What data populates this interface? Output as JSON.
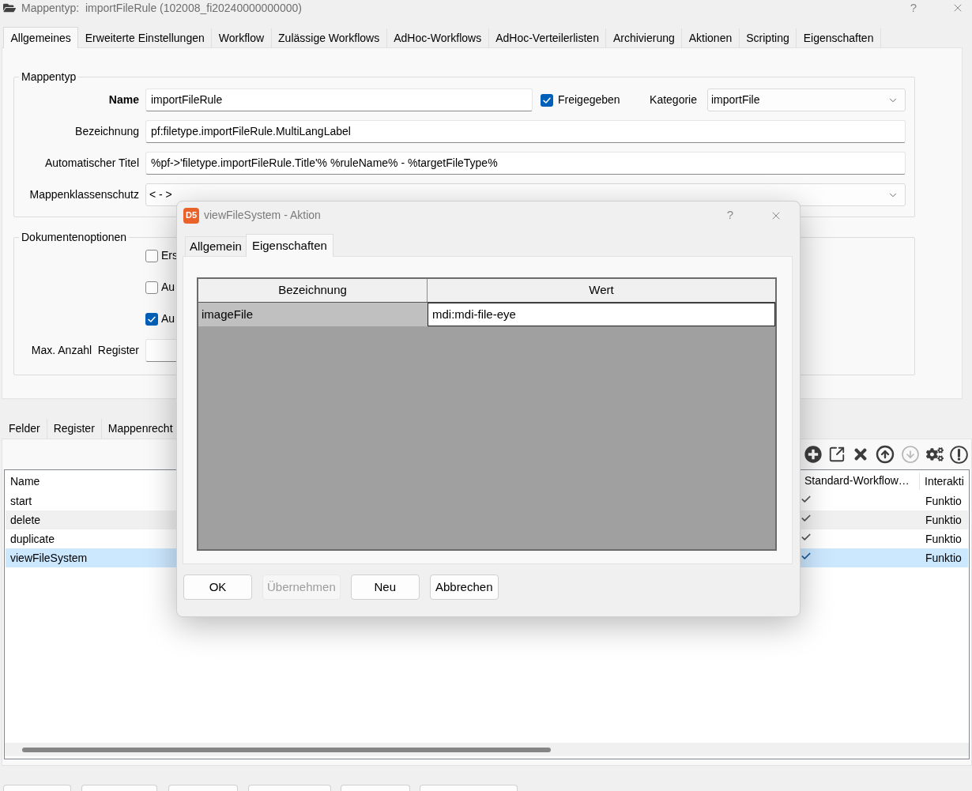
{
  "window": {
    "title": "Mappentyp:  importFileRule (102008_fi20240000000000)",
    "help": "?"
  },
  "tabs": [
    {
      "label": "Allgemeines",
      "selected": true
    },
    {
      "label": "Erweiterte Einstellungen",
      "selected": false
    },
    {
      "label": "Workflow",
      "selected": false
    },
    {
      "label": "Zulässige Workflows",
      "selected": false
    },
    {
      "label": "AdHoc-Workflows",
      "selected": false
    },
    {
      "label": "AdHoc-Verteilerlisten",
      "selected": false
    },
    {
      "label": "Archivierung",
      "selected": false
    },
    {
      "label": "Aktionen",
      "selected": false
    },
    {
      "label": "Scripting",
      "selected": false
    },
    {
      "label": "Eigenschaften",
      "selected": false
    }
  ],
  "mappentyp": {
    "legend": "Mappentyp",
    "name": {
      "label": "Name",
      "value": "importFileRule"
    },
    "released": {
      "label": "Freigegeben",
      "checked": true
    },
    "category": {
      "label": "Kategorie",
      "value": "importFile"
    },
    "designation": {
      "label": "Bezeichnung",
      "value": "pf:filetype.importFileRule.MultiLangLabel"
    },
    "auto_title": {
      "label": "Automatischer Titel",
      "value": "%pf->'filetype.importFileRule.Title'% %ruleName% - %targetFileType%"
    },
    "class_protection": {
      "label": "Mappenklassenschutz",
      "value": "< - >"
    }
  },
  "document_options": {
    "legend": "Dokumentenoptionen",
    "options": [
      {
        "label": "Ers",
        "checked": false
      },
      {
        "label": "Au",
        "checked": false
      },
      {
        "label": "Au",
        "checked": true
      }
    ],
    "max_register": {
      "label": "Max. Anzahl  Register"
    }
  },
  "lower_tabs": [
    {
      "label": "Felder",
      "selected": false
    },
    {
      "label": "Register",
      "selected": false
    },
    {
      "label": "Mappenrecht",
      "selected": false
    }
  ],
  "toolbar": [
    {
      "kind": "add",
      "disabled": false
    },
    {
      "kind": "open",
      "disabled": false
    },
    {
      "kind": "delete",
      "disabled": false
    },
    {
      "kind": "move_up",
      "disabled": false
    },
    {
      "kind": "move_down",
      "disabled": true
    },
    {
      "kind": "settings",
      "disabled": false
    },
    {
      "kind": "info",
      "disabled": false
    }
  ],
  "actions_table": {
    "columns": [
      "Name",
      "Standard-Workflow…",
      "Interakti"
    ],
    "rows": [
      {
        "name": "start",
        "standard_workflow": true,
        "interaction": "Funktio",
        "selected": false
      },
      {
        "name": "delete",
        "standard_workflow": true,
        "interaction": "Funktio",
        "selected": false
      },
      {
        "name": "duplicate",
        "standard_workflow": true,
        "interaction": "Funktio",
        "selected": false
      },
      {
        "name": "viewFileSystem",
        "standard_workflow": true,
        "interaction": "Funktio",
        "selected": true
      }
    ]
  },
  "dialog": {
    "logo": "D5",
    "title": "viewFileSystem - Aktion",
    "help": "?",
    "tabs": [
      {
        "label": "Allgemein",
        "selected": false
      },
      {
        "label": "Eigenschaften",
        "selected": true
      }
    ],
    "table": {
      "columns": [
        "Bezeichnung",
        "Wert"
      ],
      "rows": [
        {
          "name": "imageFile",
          "value": "mdi:mdi-file-eye"
        }
      ]
    },
    "buttons": [
      {
        "label": "OK",
        "disabled": false
      },
      {
        "label": "Übernehmen",
        "disabled": true
      },
      {
        "label": "Neu",
        "disabled": false
      },
      {
        "label": "Abbrechen",
        "disabled": false
      }
    ]
  }
}
